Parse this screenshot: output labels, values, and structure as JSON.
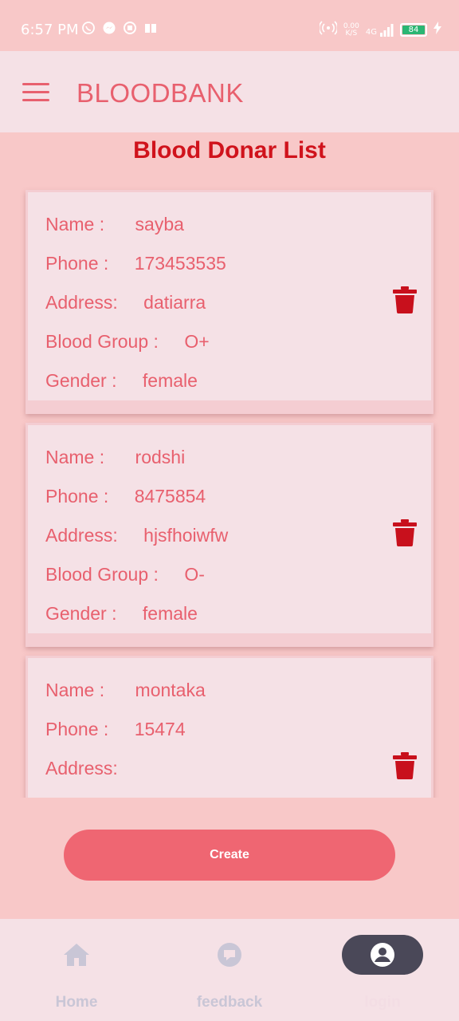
{
  "status_bar": {
    "time": "6:57 PM",
    "net_speed_top": "0.00",
    "net_speed_bottom": "K/S",
    "network": "4G",
    "battery": "84"
  },
  "app_bar": {
    "title": "BLOODBANK",
    "menu_icon": "hamburger-menu-icon"
  },
  "page": {
    "title": "Blood Donar List"
  },
  "labels": {
    "name": "Name :",
    "phone": "Phone :",
    "address": "Address:",
    "blood_group": "Blood Group :",
    "gender": "Gender :"
  },
  "donors": [
    {
      "name": "sayba",
      "phone": "173453535",
      "address": "datiarra",
      "blood_group": "O+",
      "gender": "female"
    },
    {
      "name": "rodshi",
      "phone": "8475854",
      "address": "hjsfhoiwfw",
      "blood_group": "O-",
      "gender": "female"
    },
    {
      "name": "montaka",
      "phone": "15474",
      "address": "",
      "blood_group": "",
      "gender": ""
    }
  ],
  "create_button": {
    "label": "Create"
  },
  "bottom_nav": {
    "items": [
      {
        "label": "Home",
        "icon": "home-icon"
      },
      {
        "label": "feedback",
        "icon": "feedback-icon"
      },
      {
        "label": "login",
        "icon": "account-circle-icon",
        "selected": true
      }
    ]
  },
  "colors": {
    "background": "#f8c8c8",
    "card": "#f5e1e6",
    "accent": "#e8606e",
    "title_red": "#d0131c",
    "delete_red": "#c8101c",
    "button": "#ef6672"
  }
}
